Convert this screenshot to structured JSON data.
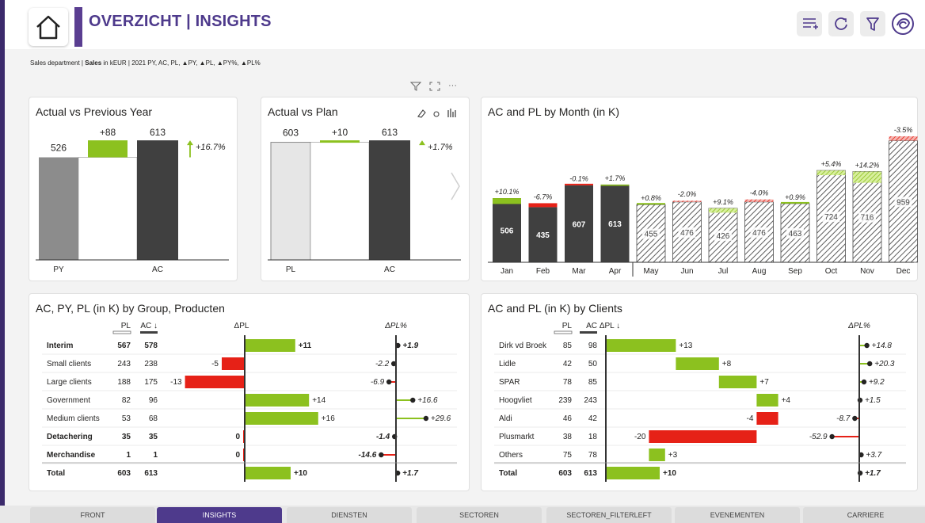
{
  "header": {
    "title": "OVERZICHT | INSIGHTS",
    "icons": [
      "home-icon",
      "add-list-icon",
      "refresh-icon",
      "filter-icon",
      "brand-logo-icon"
    ],
    "accent": "#4e3a8c"
  },
  "subtitle": {
    "prefix": "Sales department | ",
    "bold": "Sales",
    "rest": " in kEUR | 2021 PY, AC, PL, ▲PY, ▲PL, ▲PY%, ▲PL%"
  },
  "visual_tools": {
    "more": "···"
  },
  "panels": {
    "avpy": {
      "title": "Actual vs Previous Year"
    },
    "avpl": {
      "title": "Actual vs Plan"
    },
    "month": {
      "title": "AC and PL by Month (in K)"
    },
    "group": {
      "title": "AC, PY, PL (in K) by Group, Producten"
    },
    "clients": {
      "title": "AC and PL (in K) by Clients"
    }
  },
  "colors": {
    "ac": "#404040",
    "py": "#8c8c8c",
    "pl_fill": "#e6e6e6",
    "pos": "#8cc11f",
    "neg": "#e62117"
  },
  "chart_data": [
    {
      "type": "bar",
      "title": "Actual vs Previous Year",
      "categories": [
        "PY",
        "AC"
      ],
      "values": [
        526,
        613
      ],
      "delta": 88,
      "delta_pct_label": "+16.7%"
    },
    {
      "type": "bar",
      "title": "Actual vs Plan",
      "categories": [
        "PL",
        "AC"
      ],
      "values": [
        603,
        613
      ],
      "delta": 10,
      "delta_pct_label": "+1.7%"
    },
    {
      "type": "bar",
      "title": "AC and PL by Month (in K)",
      "categories": [
        "Jan",
        "Feb",
        "Mar",
        "Apr",
        "May",
        "Jun",
        "Jul",
        "Aug",
        "Sep",
        "Oct",
        "Nov",
        "Dec"
      ],
      "series": [
        {
          "name": "AC",
          "values": [
            506,
            435,
            607,
            613,
            null,
            null,
            null,
            null,
            null,
            null,
            null,
            null
          ]
        },
        {
          "name": "PL",
          "values": [
            460,
            466,
            608,
            603,
            451,
            486,
            391,
            496,
            459,
            687,
            627,
            994
          ]
        },
        {
          "name": "FC",
          "values": [
            null,
            null,
            null,
            null,
            455,
            476,
            426,
            476,
            463,
            724,
            716,
            959
          ]
        }
      ],
      "delta_labels": [
        "+10.1%",
        "-6.7%",
        "-0.1%",
        "+1.7%",
        "+0.8%",
        "-2.0%",
        "+9.1%",
        "-4.0%",
        "+0.9%",
        "+5.4%",
        "+14.2%",
        "-3.5%"
      ],
      "value_labels": [
        "506",
        "435",
        "607",
        "613",
        "455",
        "476",
        "426",
        "476",
        "463",
        "724",
        "716",
        "959"
      ]
    },
    {
      "type": "table",
      "title": "AC, PY, PL (in K) by Group, Producten",
      "columns": [
        "PL",
        "AC ↓",
        "ΔPL",
        "ΔPL%"
      ],
      "rows": [
        {
          "name": "Interim",
          "pl": "567",
          "ac": "578",
          "d": 11,
          "dl": "+11",
          "p": 1.9,
          "pl_pct": "+1.9",
          "bold": true
        },
        {
          "name": "Small clients",
          "pl": "243",
          "ac": "238",
          "d": -5,
          "dl": "-5",
          "p": -2.2,
          "pl_pct": "-2.2",
          "bold": false
        },
        {
          "name": "Large clients",
          "pl": "188",
          "ac": "175",
          "d": -13,
          "dl": "-13",
          "p": -6.9,
          "pl_pct": "-6.9",
          "bold": false
        },
        {
          "name": "Government",
          "pl": "82",
          "ac": "96",
          "d": 14,
          "dl": "+14",
          "p": 16.6,
          "pl_pct": "+16.6",
          "bold": false
        },
        {
          "name": "Medium clients",
          "pl": "53",
          "ac": "68",
          "d": 16,
          "dl": "+16",
          "p": 29.6,
          "pl_pct": "+29.6",
          "bold": false
        },
        {
          "name": "Detachering",
          "pl": "35",
          "ac": "35",
          "d": 0,
          "dl": "0",
          "p": -1.4,
          "pl_pct": "-1.4",
          "bold": true
        },
        {
          "name": "Merchandise",
          "pl": "1",
          "ac": "1",
          "d": 0,
          "dl": "0",
          "p": -14.6,
          "pl_pct": "-14.6",
          "bold": true
        },
        {
          "name": "Total",
          "pl": "603",
          "ac": "613",
          "d": 10,
          "dl": "+10",
          "p": 1.7,
          "pl_pct": "+1.7",
          "bold": true
        }
      ]
    },
    {
      "type": "table",
      "title": "AC and PL (in K) by Clients",
      "columns": [
        "PL",
        "AC",
        "ΔPL ↓",
        "ΔPL%"
      ],
      "rows": [
        {
          "name": "Dirk vd Broek",
          "pl": "85",
          "ac": "98",
          "d": 13,
          "dl": "+13",
          "p": 14.8,
          "pl_pct": "+14.8",
          "bold": false
        },
        {
          "name": "Lidle",
          "pl": "42",
          "ac": "50",
          "d": 8,
          "dl": "+8",
          "p": 20.3,
          "pl_pct": "+20.3",
          "bold": false
        },
        {
          "name": "SPAR",
          "pl": "78",
          "ac": "85",
          "d": 7,
          "dl": "+7",
          "p": 9.2,
          "pl_pct": "+9.2",
          "bold": false
        },
        {
          "name": "Hoogvliet",
          "pl": "239",
          "ac": "243",
          "d": 4,
          "dl": "+4",
          "p": 1.5,
          "pl_pct": "+1.5",
          "bold": false
        },
        {
          "name": "Aldi",
          "pl": "46",
          "ac": "42",
          "d": -4,
          "dl": "-4",
          "p": -8.7,
          "pl_pct": "-8.7",
          "bold": false
        },
        {
          "name": "Plusmarkt",
          "pl": "38",
          "ac": "18",
          "d": -20,
          "dl": "-20",
          "p": -52.9,
          "pl_pct": "-52.9",
          "bold": false
        },
        {
          "name": "Others",
          "pl": "75",
          "ac": "78",
          "d": 3,
          "dl": "+3",
          "p": 3.7,
          "pl_pct": "+3.7",
          "bold": false
        },
        {
          "name": "Total",
          "pl": "603",
          "ac": "613",
          "d": 10,
          "dl": "+10",
          "p": 1.7,
          "pl_pct": "+1.7",
          "bold": true
        }
      ]
    }
  ],
  "tabs": [
    {
      "label": "FRONT",
      "active": false
    },
    {
      "label": "INSIGHTS",
      "active": true
    },
    {
      "label": "DIENSTEN",
      "active": false
    },
    {
      "label": "SECTOREN",
      "active": false
    },
    {
      "label": "SECTOREN_FILTERLEFT",
      "active": false
    },
    {
      "label": "EVENEMENTEN",
      "active": false
    },
    {
      "label": "CARRIERE",
      "active": false
    }
  ]
}
